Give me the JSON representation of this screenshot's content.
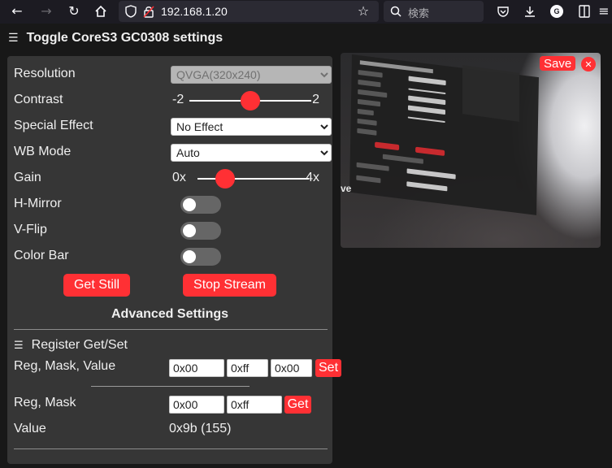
{
  "browser": {
    "url": "192.168.1.20",
    "search_placeholder": "検索",
    "profile_initial": "G"
  },
  "page": {
    "title": "Toggle CoreS3 GC0308 settings"
  },
  "settings": {
    "resolution": {
      "label": "Resolution",
      "value": "QVGA(320x240)"
    },
    "contrast": {
      "label": "Contrast",
      "min_label": "-2",
      "max_label": "2",
      "value": 0,
      "min": -2,
      "max": 2
    },
    "special_effect": {
      "label": "Special Effect",
      "value": "No Effect"
    },
    "wb_mode": {
      "label": "WB Mode",
      "value": "Auto"
    },
    "gain": {
      "label": "Gain",
      "min_label": "0x",
      "max_label": "4x",
      "value": 1,
      "min": 0,
      "max": 4
    },
    "hmirror": {
      "label": "H-Mirror",
      "on": false
    },
    "vflip": {
      "label": "V-Flip",
      "on": false
    },
    "colorbar": {
      "label": "Color Bar",
      "on": false
    }
  },
  "buttons": {
    "get_still": "Get Still",
    "stop_stream": "Stop Stream"
  },
  "advanced": {
    "heading": "Advanced Settings",
    "register_title": "Register Get/Set",
    "reg_mask_value_label": "Reg, Mask, Value",
    "set_reg": "0x00",
    "set_mask": "0xff",
    "set_value": "0x00",
    "set_label": "Set",
    "reg_mask_label": "Reg, Mask",
    "get_reg": "0x00",
    "get_mask": "0xff",
    "get_label": "Get",
    "value_label": "Value",
    "value_text": "0x9b (155)"
  },
  "preview": {
    "save_label": "Save",
    "close_glyph": "✕",
    "left_text": "ve"
  },
  "colors": {
    "accent": "#ff3034",
    "panel": "#363636",
    "background": "#181818"
  }
}
